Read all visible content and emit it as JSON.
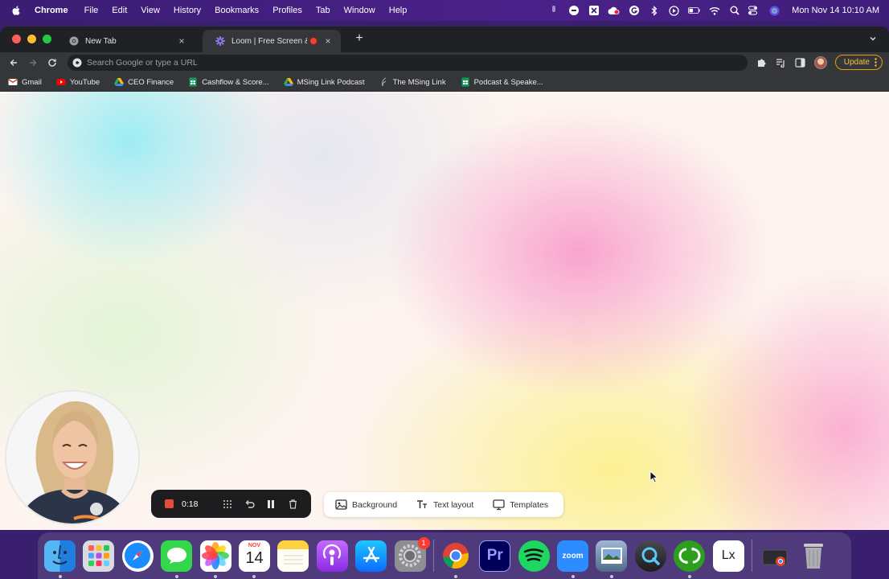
{
  "menubar": {
    "app_name": "Chrome",
    "items": [
      "File",
      "Edit",
      "View",
      "History",
      "Bookmarks",
      "Profiles",
      "Tab",
      "Window",
      "Help"
    ],
    "clock": "Mon Nov 14  10:10 AM"
  },
  "browser": {
    "tabs": [
      {
        "title": "New Tab"
      },
      {
        "title": "Loom | Free Screen & Vide"
      }
    ],
    "omnibox_placeholder": "Search Google or type a URL",
    "update_label": "Update",
    "bookmarks": [
      {
        "label": "Gmail",
        "icon": "gmail-icon"
      },
      {
        "label": "YouTube",
        "icon": "youtube-icon"
      },
      {
        "label": "CEO Finance",
        "icon": "drive-icon"
      },
      {
        "label": "Cashflow & Score...",
        "icon": "sheets-icon"
      },
      {
        "label": "MSing Link Podcast",
        "icon": "drive-icon"
      },
      {
        "label": "The MSing Link",
        "icon": "feather-icon"
      },
      {
        "label": "Podcast & Speake...",
        "icon": "sheets-icon"
      }
    ]
  },
  "loom": {
    "timer": "0:18",
    "effects": {
      "background": "Background",
      "text_layout": "Text layout",
      "templates": "Templates"
    }
  },
  "dock": {
    "calendar_month": "NOV",
    "calendar_day": "14",
    "settings_badge": "1",
    "premiere_label": "Pr",
    "zoom_label": "zoom",
    "lx_label": "Lx"
  },
  "colors": {
    "menubar": "#3b1d74",
    "chrome_frame": "#202124",
    "chrome_toolbar": "#35363a",
    "record_stop": "#e64a3c",
    "update_accent": "#e3a008"
  }
}
